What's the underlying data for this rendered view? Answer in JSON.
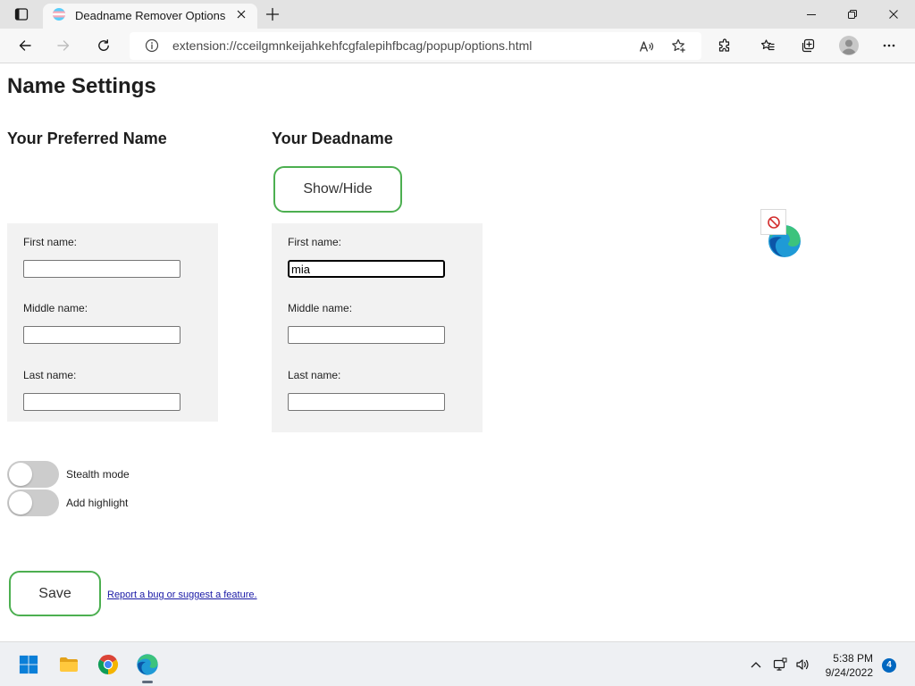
{
  "browser": {
    "tab_title": "Deadname Remover Options",
    "url": "extension://cceilgmnkeijahkehfcgfalepihfbcag/popup/options.html"
  },
  "page": {
    "title": "Name Settings",
    "preferred": {
      "heading": "Your Preferred Name",
      "fields": [
        {
          "label": "First name:",
          "value": ""
        },
        {
          "label": "Middle name:",
          "value": ""
        },
        {
          "label": "Last name:",
          "value": ""
        }
      ]
    },
    "deadname": {
      "heading": "Your Deadname",
      "toggle_button": "Show/Hide",
      "fields": [
        {
          "label": "First name:",
          "value": "mia",
          "focused": true
        },
        {
          "label": "Middle name:",
          "value": ""
        },
        {
          "label": "Last name:",
          "value": ""
        }
      ]
    },
    "switches": [
      {
        "label": "Stealth mode",
        "checked": false
      },
      {
        "label": "Add highlight",
        "checked": false
      }
    ],
    "save_button": "Save",
    "report_link": "Report a bug or suggest a feature."
  },
  "taskbar": {
    "apps": [
      "start-icon",
      "file-explorer-icon",
      "chrome-icon",
      "edge-icon"
    ],
    "active_app": "edge-icon",
    "time": "5:38 PM",
    "date": "9/24/2022",
    "notification_count": "4"
  },
  "colors": {
    "accent_border": "#4caf50",
    "link": "#1a1aa6",
    "focus_border": "#000000",
    "notification_badge": "#0067c0"
  }
}
